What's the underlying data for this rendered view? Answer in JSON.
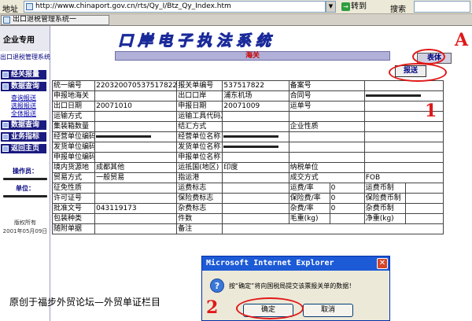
{
  "browser": {
    "address_label": "地址",
    "address_url": "http://www.chinaport.gov.cn/rts/Qy_I/Btz_Qy_Index.htm",
    "go_label": "转到",
    "search_label": "搜索",
    "tab_title": "出口退税管理系统一"
  },
  "header": {
    "left_label": "企业专用",
    "title": "口岸电子执法系统"
  },
  "sidebar": {
    "top_title": "出口退税管理系统",
    "menu": [
      {
        "label": "经关报量"
      },
      {
        "label": "数据查询"
      },
      {
        "label": "数据查询"
      },
      {
        "label": "业务指标"
      },
      {
        "label": "返回主页"
      }
    ],
    "links": [
      "查询报送",
      "选报报送",
      "全体报送"
    ],
    "operator_label": "操作员：",
    "unit_label": "单位：",
    "copyright": "版权所有",
    "copyright_date": "2001年05月09日"
  },
  "main": {
    "title": "海关",
    "top_button": "表体",
    "send_button": "报送",
    "rows": [
      [
        "统一编号",
        "220320070537517822",
        "报关单编号",
        "537517822",
        "备案号",
        ""
      ],
      [
        "申报地海关",
        "",
        "出口口岸",
        "浦东机场",
        "合同号",
        "████"
      ],
      [
        "出口日期",
        "20071010",
        "申报日期",
        "20071009",
        "运单号",
        ""
      ],
      [
        "运输方式",
        "",
        "运输工具代码及名称",
        "",
        "",
        ""
      ],
      [
        "集装箱数量",
        "",
        "结汇方式",
        "",
        "企业性质",
        ""
      ],
      [
        "经营单位编码",
        "████",
        "经营单位名称",
        "████",
        "",
        ""
      ],
      [
        "发货单位编码",
        "",
        "发货单位名称",
        "████",
        "",
        ""
      ],
      [
        "申报单位编码",
        "",
        "申报单位名称",
        "",
        "",
        ""
      ],
      [
        "境内货源地",
        "成都其他",
        "运抵国(地区)",
        "印度",
        "纳税单位",
        ""
      ],
      [
        "贸易方式",
        "一般贸易",
        "指运港",
        "",
        "成交方式",
        "FOB"
      ],
      [
        "征免性质",
        "",
        "运费标志",
        "",
        "运费/率",
        "0",
        "运费币制",
        ""
      ],
      [
        "许可证号",
        "",
        "保险费标志",
        "",
        "保险费/率",
        "0",
        "保险费币制",
        ""
      ],
      [
        "批准文号",
        "043119173",
        "杂费标志",
        "",
        "杂费/率",
        "0",
        "杂费币制",
        ""
      ],
      [
        "包装种类",
        "",
        "件数",
        "",
        "毛重(kg)",
        "",
        "净重(kg)",
        ""
      ],
      [
        "随附单据",
        "",
        "备注",
        ""
      ]
    ]
  },
  "dialog": {
    "title": "Microsoft Internet Explorer",
    "message": "按“确定”将向国税局提交该票报关单的数据！",
    "ok_label": "确定",
    "cancel_label": "取消"
  },
  "footer_text": "原创于福步外贸论坛—外贸单证栏目",
  "annotations": {
    "mark_a": "A",
    "mark_1": "1",
    "mark_2": "2"
  },
  "colors": {
    "header_bar": "#000080",
    "annotation": "#e01818",
    "dialog_title": "#1c5ad6"
  }
}
